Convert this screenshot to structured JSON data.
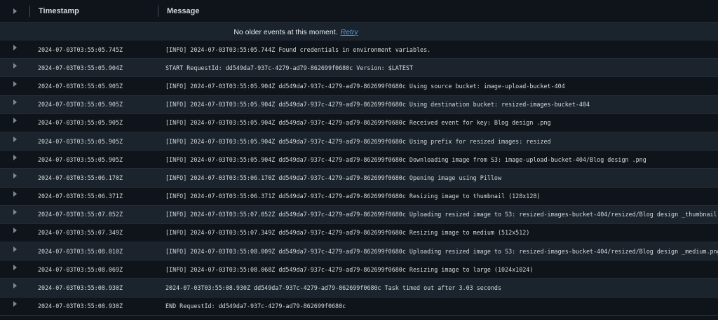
{
  "header": {
    "timestamp_label": "Timestamp",
    "message_label": "Message"
  },
  "notice": {
    "text": "No older events at this moment.",
    "retry_label": "Retry"
  },
  "rows": [
    {
      "timestamp": "2024-07-03T03:55:05.745Z",
      "message": "[INFO] 2024-07-03T03:55:05.744Z Found credentials in environment variables."
    },
    {
      "timestamp": "2024-07-03T03:55:05.904Z",
      "message": "START RequestId: dd549da7-937c-4279-ad79-862699f0680c Version: $LATEST"
    },
    {
      "timestamp": "2024-07-03T03:55:05.905Z",
      "message": "[INFO] 2024-07-03T03:55:05.904Z dd549da7-937c-4279-ad79-862699f0680c Using source bucket: image-upload-bucket-404"
    },
    {
      "timestamp": "2024-07-03T03:55:05.905Z",
      "message": "[INFO] 2024-07-03T03:55:05.904Z dd549da7-937c-4279-ad79-862699f0680c Using destination bucket: resized-images-bucket-404"
    },
    {
      "timestamp": "2024-07-03T03:55:05.905Z",
      "message": "[INFO] 2024-07-03T03:55:05.904Z dd549da7-937c-4279-ad79-862699f0680c Received event for key: Blog design .png"
    },
    {
      "timestamp": "2024-07-03T03:55:05.905Z",
      "message": "[INFO] 2024-07-03T03:55:05.904Z dd549da7-937c-4279-ad79-862699f0680c Using prefix for resized images: resized"
    },
    {
      "timestamp": "2024-07-03T03:55:05.905Z",
      "message": "[INFO] 2024-07-03T03:55:05.904Z dd549da7-937c-4279-ad79-862699f0680c Downloading image from S3: image-upload-bucket-404/Blog design .png"
    },
    {
      "timestamp": "2024-07-03T03:55:06.170Z",
      "message": "[INFO] 2024-07-03T03:55:06.170Z dd549da7-937c-4279-ad79-862699f0680c Opening image using Pillow"
    },
    {
      "timestamp": "2024-07-03T03:55:06.371Z",
      "message": "[INFO] 2024-07-03T03:55:06.371Z dd549da7-937c-4279-ad79-862699f0680c Resizing image to thumbnail (128x128)"
    },
    {
      "timestamp": "2024-07-03T03:55:07.052Z",
      "message": "[INFO] 2024-07-03T03:55:07.052Z dd549da7-937c-4279-ad79-862699f0680c Uploading resized image to S3: resized-images-bucket-404/resized/Blog design _thumbnail.png"
    },
    {
      "timestamp": "2024-07-03T03:55:07.349Z",
      "message": "[INFO] 2024-07-03T03:55:07.349Z dd549da7-937c-4279-ad79-862699f0680c Resizing image to medium (512x512)"
    },
    {
      "timestamp": "2024-07-03T03:55:08.010Z",
      "message": "[INFO] 2024-07-03T03:55:08.009Z dd549da7-937c-4279-ad79-862699f0680c Uploading resized image to S3: resized-images-bucket-404/resized/Blog design _medium.png"
    },
    {
      "timestamp": "2024-07-03T03:55:08.069Z",
      "message": "[INFO] 2024-07-03T03:55:08.068Z dd549da7-937c-4279-ad79-862699f0680c Resizing image to large (1024x1024)"
    },
    {
      "timestamp": "2024-07-03T03:55:08.930Z",
      "message": "2024-07-03T03:55:08.930Z dd549da7-937c-4279-ad79-862699f0680c Task timed out after 3.03 seconds"
    },
    {
      "timestamp": "2024-07-03T03:55:08.930Z",
      "message": "END RequestId: dd549da7-937c-4279-ad79-862699f0680c"
    }
  ]
}
